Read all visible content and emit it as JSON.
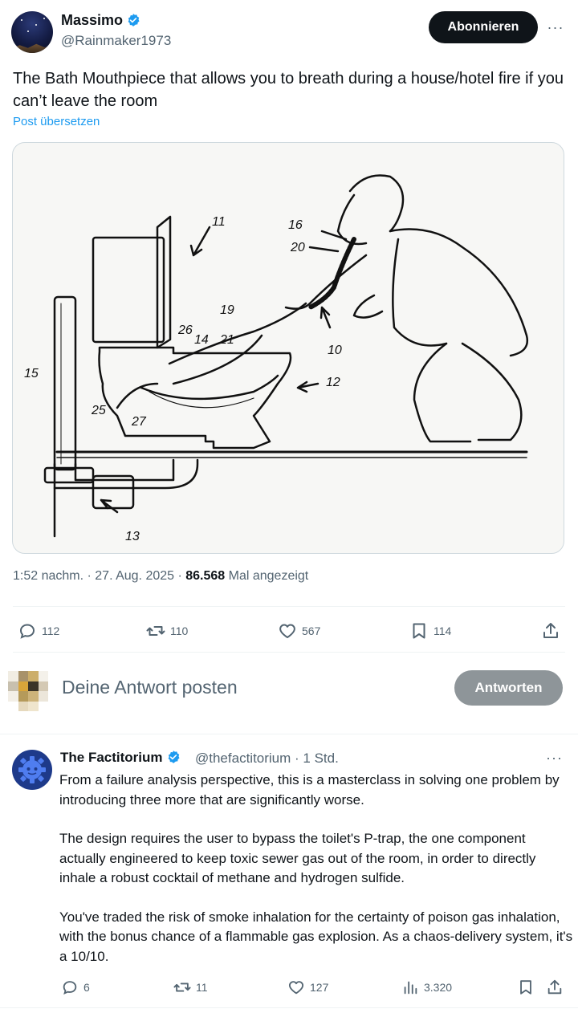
{
  "post": {
    "author_name": "Massimo",
    "author_handle": "@Rainmaker1973",
    "subscribe_label": "Abonnieren",
    "more_label": "···",
    "text": "The Bath Mouthpiece that allows you to breath during a house/hotel fire if you can’t leave the room",
    "translate_label": "Post übersetzen",
    "image_labels": [
      "11",
      "16",
      "20",
      "19",
      "26",
      "14",
      "21",
      "10",
      "12",
      "15",
      "25",
      "27",
      "13"
    ],
    "meta_time": "1:52 nachm. · 27. Aug. 2025 · ",
    "meta_views": "86.568",
    "meta_views_suffix": " Mal angezeigt",
    "stats": {
      "replies": "112",
      "reposts": "110",
      "likes": "567",
      "bookmarks": "114"
    }
  },
  "composer": {
    "placeholder": "Deine Antwort posten",
    "button_label": "Antworten"
  },
  "reply": {
    "author_name": "The Factitorium",
    "author_handle": "@thefactitorium · 1 Std.",
    "more_label": "···",
    "paragraphs": [
      "From a failure analysis perspective, this is a masterclass in solving one problem by introducing three more that are significantly worse.",
      "The design requires the user to bypass the toilet's P-trap, the one component actually engineered to keep toxic sewer gas out of the room, in order to directly inhale a robust cocktail of methane and hydrogen sulfide.",
      "You've traded the risk of smoke inhalation for the certainty of poison gas inhalation, with the bonus chance of a flammable gas explosion. As a chaos-delivery system, it's a 10/10."
    ],
    "stats": {
      "replies": "6",
      "reposts": "11",
      "likes": "127",
      "views": "3.320"
    }
  },
  "colors": {
    "link": "#1d9bf0",
    "verified": "#1d9bf0",
    "muted": "#536471",
    "text": "#0f1419"
  }
}
